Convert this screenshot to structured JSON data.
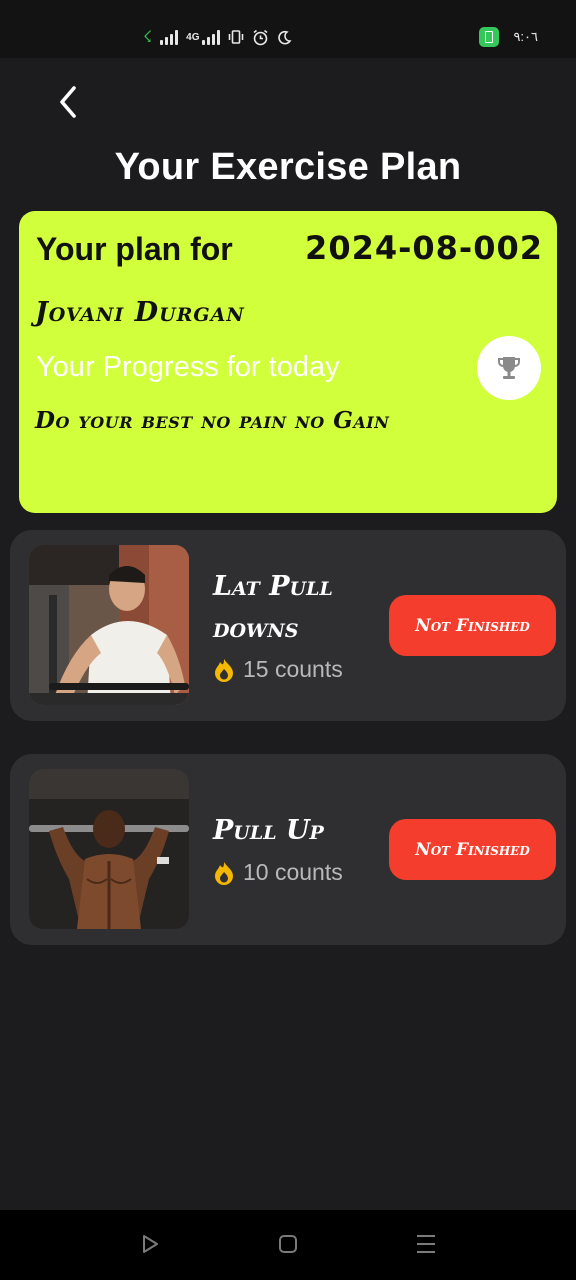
{
  "status_bar": {
    "network_label": "4G",
    "time": "٩:٠٦",
    "icons": [
      "charging-bolt-icon",
      "signal-icon",
      "signal-4g-icon",
      "vibrate-icon",
      "alarm-icon",
      "moon-icon",
      "battery-icon"
    ]
  },
  "header": {
    "back_icon": "chevron-left-icon",
    "title": "Your Exercise Plan"
  },
  "plan_card": {
    "label": "Your plan for",
    "plan_code": "2024-08-002",
    "user_name": "Jovani Durgan",
    "progress_text": "Your Progress for today",
    "motto": "Do your best no pain no Gain",
    "trophy_icon": "trophy-icon",
    "background_color": "#d2ff3c"
  },
  "exercises": [
    {
      "name": "Lat Pull downs",
      "count_text": "15 counts",
      "status": "Not Finished",
      "count_icon": "flame-icon"
    },
    {
      "name": "Pull Up",
      "count_text": "10 counts",
      "status": "Not Finished",
      "count_icon": "flame-icon"
    }
  ],
  "nav_bar": {
    "icons": [
      "back-triangle-icon",
      "home-square-icon",
      "menu-lines-icon"
    ]
  },
  "colors": {
    "background": "#1c1c1e",
    "card": "#2f2f31",
    "accent": "#d2ff3c",
    "status_button": "#f43d2d",
    "flame": "#f5b800"
  }
}
